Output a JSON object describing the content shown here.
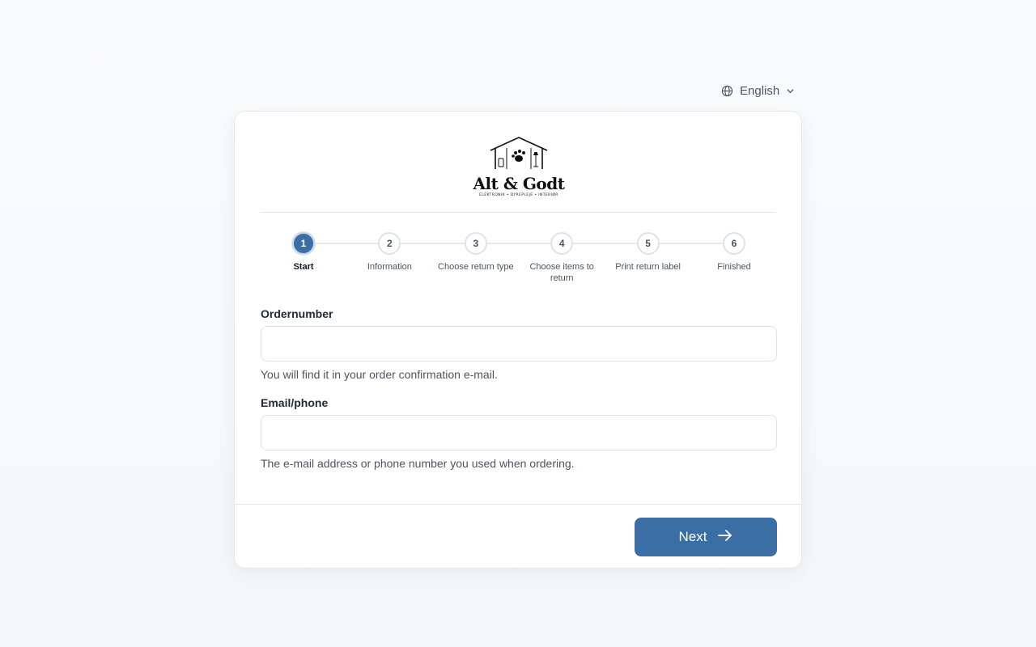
{
  "language": {
    "label": "English",
    "icon": "globe-icon",
    "chevron": "chevron-down-icon"
  },
  "brand": {
    "name": "Alt & Godt",
    "tagline": "ELEKTRONIK • DYREPLEJE • INTERIØR",
    "logo_icon": "house-logo-icon"
  },
  "steps": [
    {
      "number": "1",
      "label": "Start"
    },
    {
      "number": "2",
      "label": "Information"
    },
    {
      "number": "3",
      "label": "Choose return type"
    },
    {
      "number": "4",
      "label": "Choose items to return"
    },
    {
      "number": "5",
      "label": "Print return label"
    },
    {
      "number": "6",
      "label": "Finished"
    }
  ],
  "active_step": 1,
  "form": {
    "order": {
      "label": "Ordernumber",
      "value": "",
      "placeholder": "",
      "help": "You will find it in your order confirmation e-mail."
    },
    "contact": {
      "label": "Email/phone",
      "value": "",
      "placeholder": "",
      "help": "The e-mail address or phone number you used when ordering."
    }
  },
  "actions": {
    "next_label": "Next",
    "next_icon": "arrow-right-icon"
  },
  "colors": {
    "accent": "#3a6ea5",
    "border": "#e5e7eb",
    "muted_text": "#4b5563"
  }
}
